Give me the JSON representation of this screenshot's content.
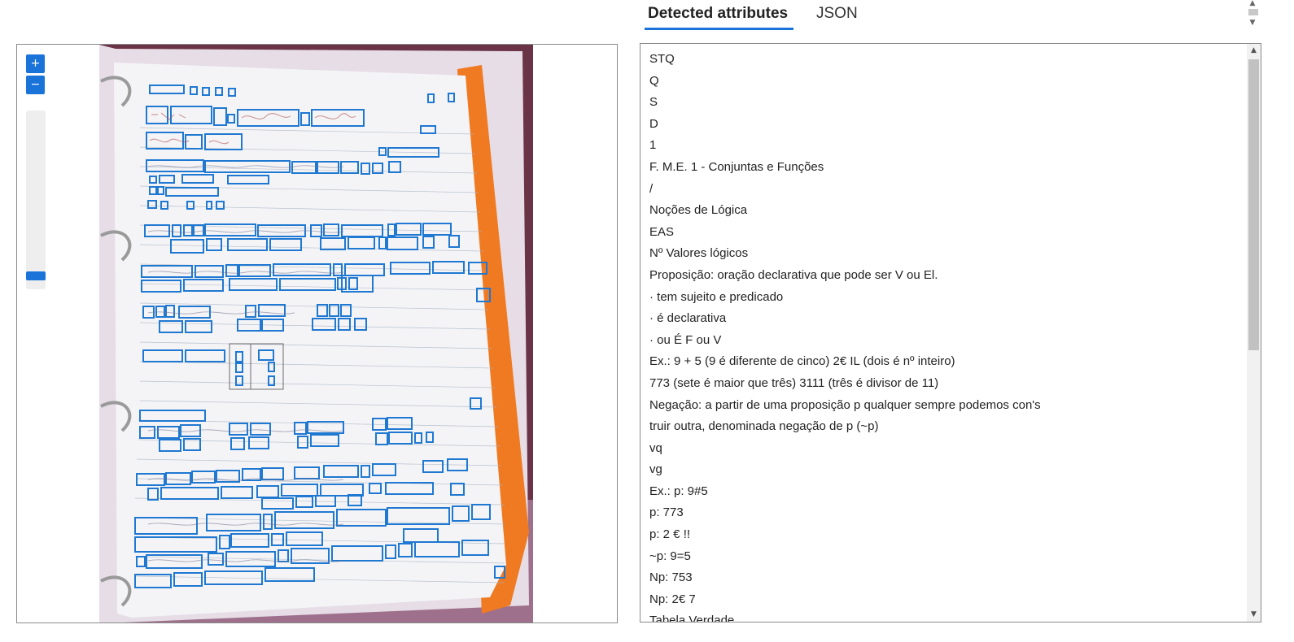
{
  "tabs": [
    {
      "label": "Detected attributes",
      "active": true
    },
    {
      "label": "JSON",
      "active": false
    }
  ],
  "viewer": {
    "zoom_in_label": "+",
    "zoom_out_label": "−"
  },
  "attributes": [
    "STQ",
    "Q",
    "S",
    "D",
    "1",
    "F. M.E. 1 - Conjuntas e Funções",
    "/",
    "Noções de Lógica",
    "EAS",
    "Nº Valores lógicos",
    "Proposição: oração declarativa que pode ser V ou El.",
    "· tem sujeito e predicado",
    "· é declarativa",
    "· ou É F ou V",
    "Ex.: 9 + 5 (9 é diferente de cinco) 2€ IL (dois é nº inteiro)",
    "773 (sete é maior que três) 3111 (três é divisor de 11)",
    "Negação: a partir de uma proposição p qualquer sempre podemos con's",
    "truir outra, denominada negação de p (~p)",
    "vq",
    "vg",
    "Ex.: p: 9#5",
    "p: 773",
    "p: 2 € !!",
    "~p: 9=5",
    "Np: 753",
    "Np: 2€ 7",
    "Tabela Verdade"
  ],
  "colors": {
    "accent": "#1a73d9",
    "box_stroke": "#1f78d1"
  }
}
